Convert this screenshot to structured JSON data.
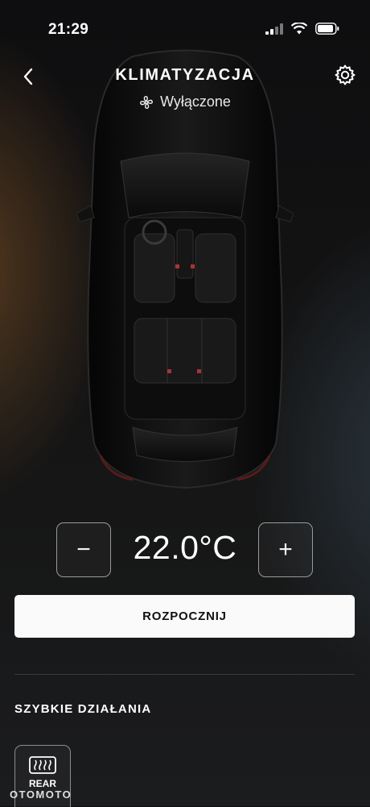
{
  "status_bar": {
    "time": "21:29"
  },
  "header": {
    "title": "KLIMATYZACJA",
    "status_text": "Wyłączone"
  },
  "icons": {
    "back": "chevron-left-icon",
    "settings": "gear-icon",
    "status": "fan-icon",
    "quick_action_1": "rear-defrost-icon"
  },
  "climate": {
    "temperature": "22.0°C",
    "minus_label": "−",
    "plus_label": "+"
  },
  "actions": {
    "start_label": "ROZPOCZNIJ"
  },
  "quick_actions": {
    "title": "SZYBKIE DZIAŁANIA",
    "items": [
      {
        "label": "REAR"
      }
    ]
  },
  "watermark": "OTOMOTO",
  "colors": {
    "accent_button_bg": "#fafafa",
    "accent_button_text": "#111111",
    "divider": "#3b3b3b"
  }
}
